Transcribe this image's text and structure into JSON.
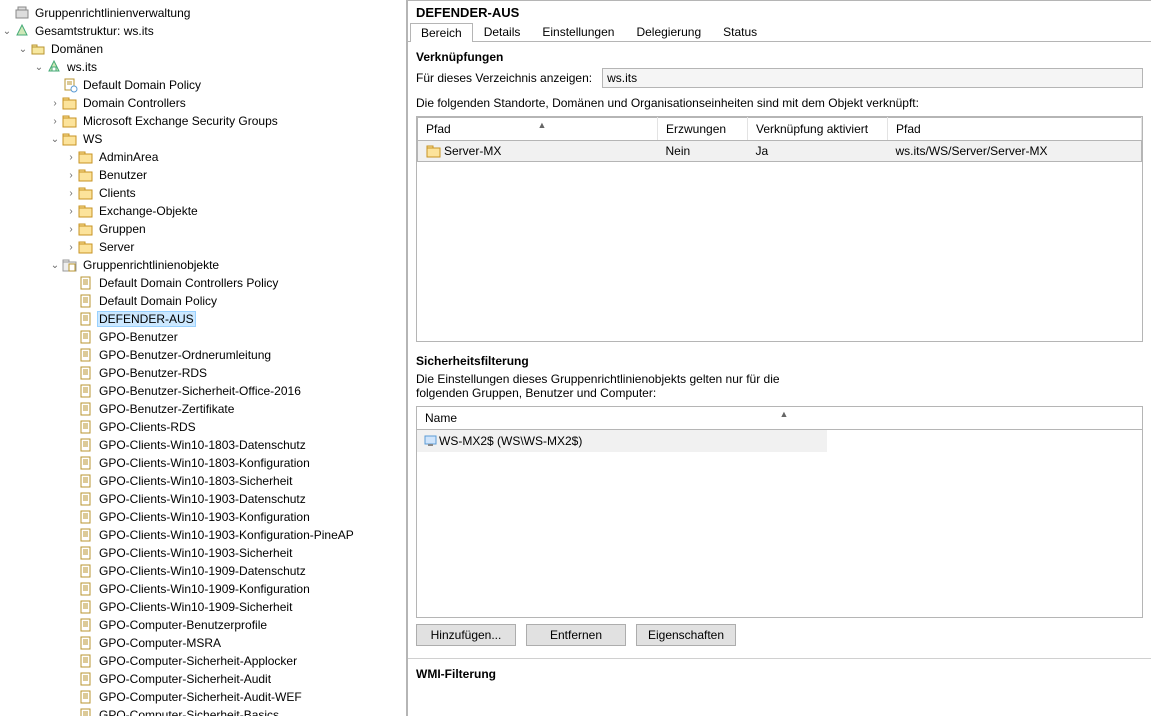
{
  "tree": {
    "root": "Gruppenrichtlinienverwaltung",
    "forest": "Gesamtstruktur: ws.its",
    "domainsLabel": "Domänen",
    "domain": "ws.its",
    "domainChildren": [
      {
        "label": "Default Domain Policy",
        "kind": "link",
        "expandable": false
      },
      {
        "label": "Domain Controllers",
        "kind": "ou",
        "expandable": true
      },
      {
        "label": "Microsoft Exchange Security Groups",
        "kind": "ou",
        "expandable": true
      },
      {
        "label": "WS",
        "kind": "ou",
        "expandable": true,
        "expanded": true
      }
    ],
    "wsChildren": [
      {
        "label": "AdminArea",
        "kind": "ou"
      },
      {
        "label": "Benutzer",
        "kind": "ou"
      },
      {
        "label": "Clients",
        "kind": "ou"
      },
      {
        "label": "Exchange-Objekte",
        "kind": "ou"
      },
      {
        "label": "Gruppen",
        "kind": "ou"
      },
      {
        "label": "Server",
        "kind": "ou"
      }
    ],
    "gpoContainerLabel": "Gruppenrichtlinienobjekte",
    "gpoList": [
      "Default Domain Controllers Policy",
      "Default Domain Policy",
      "DEFENDER-AUS",
      "GPO-Benutzer",
      "GPO-Benutzer-Ordnerumleitung",
      "GPO-Benutzer-RDS",
      "GPO-Benutzer-Sicherheit-Office-2016",
      "GPO-Benutzer-Zertifikate",
      "GPO-Clients-RDS",
      "GPO-Clients-Win10-1803-Datenschutz",
      "GPO-Clients-Win10-1803-Konfiguration",
      "GPO-Clients-Win10-1803-Sicherheit",
      "GPO-Clients-Win10-1903-Datenschutz",
      "GPO-Clients-Win10-1903-Konfiguration",
      "GPO-Clients-Win10-1903-Konfiguration-PineAP",
      "GPO-Clients-Win10-1903-Sicherheit",
      "GPO-Clients-Win10-1909-Datenschutz",
      "GPO-Clients-Win10-1909-Konfiguration",
      "GPO-Clients-Win10-1909-Sicherheit",
      "GPO-Computer-Benutzerprofile",
      "GPO-Computer-MSRA",
      "GPO-Computer-Sicherheit-Applocker",
      "GPO-Computer-Sicherheit-Audit",
      "GPO-Computer-Sicherheit-Audit-WEF",
      "GPO-Computer-Sicherheit-Basics"
    ],
    "selectedGpo": "DEFENDER-AUS"
  },
  "detail": {
    "title": "DEFENDER-AUS",
    "tabs": [
      "Bereich",
      "Details",
      "Einstellungen",
      "Delegierung",
      "Status"
    ],
    "activeTab": "Bereich",
    "links": {
      "sectionTitle": "Verknüpfungen",
      "locLabel": "Für dieses Verzeichnis anzeigen:",
      "locValue": "ws.its",
      "desc": "Die folgenden Standorte, Domänen und Organisationseinheiten sind mit dem Objekt verknüpft:",
      "cols": [
        "Pfad",
        "Erzwungen",
        "Verknüpfung aktiviert",
        "Pfad"
      ],
      "rows": [
        {
          "name": "Server-MX",
          "forced": "Nein",
          "enabled": "Ja",
          "path": "ws.its/WS/Server/Server-MX"
        }
      ]
    },
    "filter": {
      "sectionTitle": "Sicherheitsfilterung",
      "desc": "Die Einstellungen dieses Gruppenrichtlinienobjekts gelten nur für die folgenden Gruppen, Benutzer und Computer:",
      "col": "Name",
      "rows": [
        "WS-MX2$ (WS\\WS-MX2$)"
      ],
      "buttons": {
        "add": "Hinzufügen...",
        "remove": "Entfernen",
        "props": "Eigenschaften"
      }
    },
    "wmiTitle": "WMI-Filterung"
  }
}
